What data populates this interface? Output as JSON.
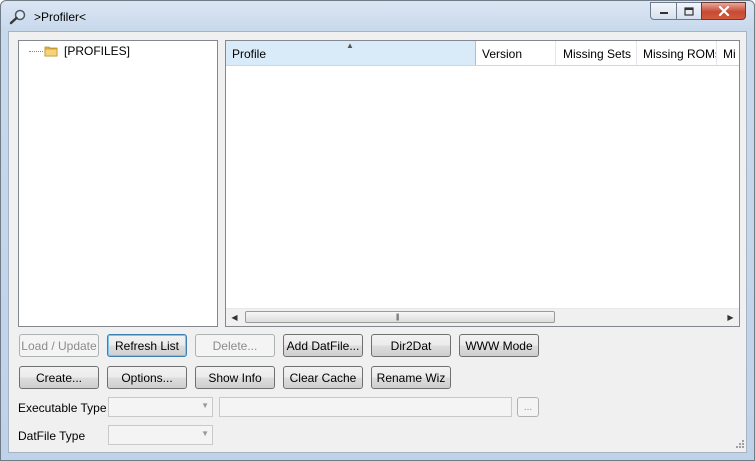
{
  "window": {
    "title": ">Profiler<"
  },
  "tree": {
    "root_label": "[PROFILES]"
  },
  "list": {
    "columns": [
      "Profile",
      "Version",
      "Missing Sets",
      "Missing ROMs",
      "Mi"
    ],
    "sorted_column": "Profile",
    "sort_direction": "ascending",
    "rows": []
  },
  "buttons_row1": {
    "load_update": "Load / Update",
    "refresh_list": "Refresh List",
    "delete": "Delete...",
    "add_datfile": "Add DatFile...",
    "dir2dat": "Dir2Dat",
    "www_mode": "WWW Mode"
  },
  "buttons_row2": {
    "create": "Create...",
    "options": "Options...",
    "show_info": "Show Info",
    "clear_cache": "Clear Cache",
    "rename_wiz": "Rename Wiz"
  },
  "fields": {
    "executable_type_label": "Executable Type",
    "executable_type_value": "",
    "executable_path_value": "",
    "browse_label": "...",
    "datfile_type_label": "DatFile Type",
    "datfile_type_value": ""
  }
}
